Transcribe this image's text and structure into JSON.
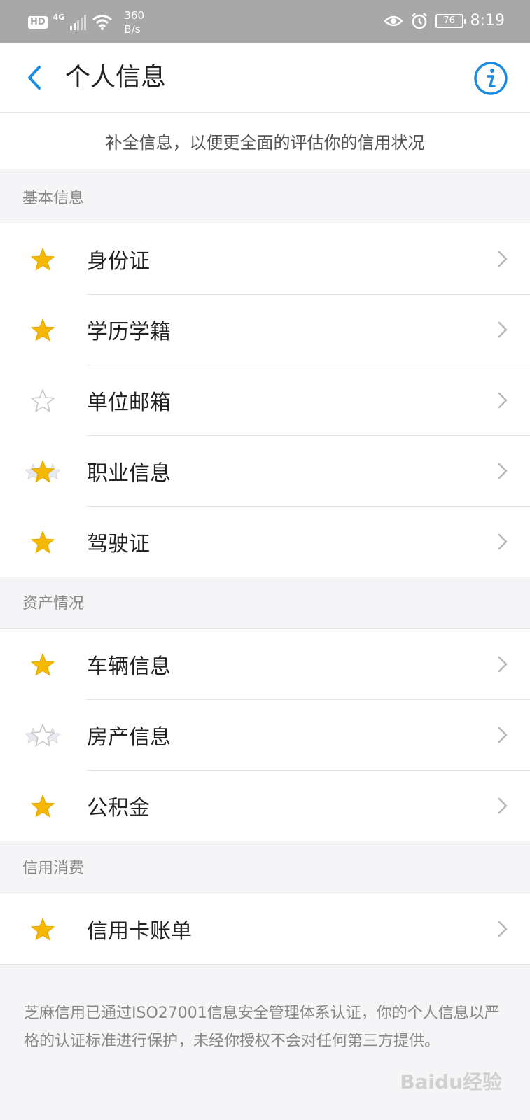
{
  "status_bar": {
    "hd": "HD",
    "network": "4G",
    "speed_value": "360",
    "speed_unit": "B/s",
    "battery": "76",
    "time": "8:19"
  },
  "header": {
    "title": "个人信息"
  },
  "banner": {
    "text": "补全信息，以便更全面的评估你的信用状况"
  },
  "sections": [
    {
      "title": "基本信息",
      "items": [
        {
          "label": "身份证",
          "star": "filled"
        },
        {
          "label": "学历学籍",
          "star": "filled"
        },
        {
          "label": "单位邮箱",
          "star": "outline"
        },
        {
          "label": "职业信息",
          "star": "filled-stack"
        },
        {
          "label": "驾驶证",
          "star": "filled"
        }
      ]
    },
    {
      "title": "资产情况",
      "items": [
        {
          "label": "车辆信息",
          "star": "filled"
        },
        {
          "label": "房产信息",
          "star": "outline-stack"
        },
        {
          "label": "公积金",
          "star": "filled"
        }
      ]
    },
    {
      "title": "信用消费",
      "items": [
        {
          "label": "信用卡账单",
          "star": "filled"
        }
      ]
    }
  ],
  "footer": {
    "note": "芝麻信用已通过ISO27001信息安全管理体系认证，你的个人信息以严格的认证标准进行保护，未经你授权不会对任何第三方提供。",
    "watermark": "Baidu经验"
  },
  "colors": {
    "accent": "#1a8be0",
    "star": "#f5b800"
  },
  "icons": {
    "back": "chevron-left-icon",
    "info": "info-icon",
    "row_arrow": "chevron-right-icon",
    "star": "star-icon"
  }
}
